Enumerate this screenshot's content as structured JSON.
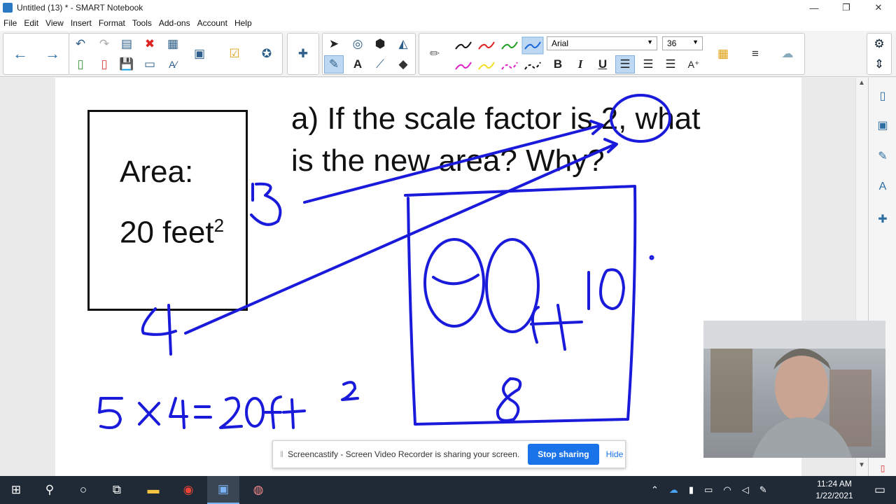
{
  "window": {
    "title": "Untitled (13) * - SMART Notebook",
    "minimize": "—",
    "restore": "❐",
    "close": "✕"
  },
  "menu": [
    "File",
    "Edit",
    "View",
    "Insert",
    "Format",
    "Tools",
    "Add-ons",
    "Account",
    "Help"
  ],
  "toolbar": {
    "font_name": "Arial",
    "font_size": "36",
    "bold_label": "B",
    "italic_label": "I",
    "underline_label": "U",
    "pen_colors": [
      "#111111",
      "#e02020",
      "#20a020",
      "#1a66d8",
      "#e020c8",
      "#f0e020",
      "#e020c8",
      "#111111"
    ]
  },
  "canvas": {
    "box_line1": "Area:",
    "box_line2": "20 feet",
    "box_sup": "2",
    "question_line1": "a) If the scale factor is 2, what",
    "question_line2": "is the new area? Why?",
    "ink_color": "#1a1adb"
  },
  "share_bar": {
    "message": "Screencastify - Screen Video Recorder is sharing your screen.",
    "stop_label": "Stop sharing",
    "hide_label": "Hide"
  },
  "taskbar": {
    "time": "11:24 AM",
    "date": "1/22/2021"
  }
}
